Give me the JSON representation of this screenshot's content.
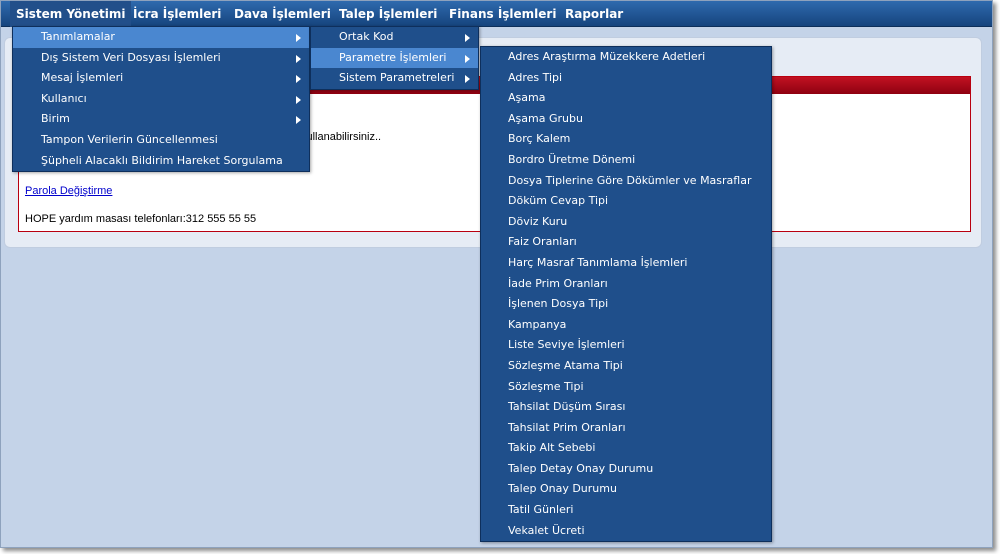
{
  "menubar": {
    "items": [
      {
        "label": "Sistem Yönetimi"
      },
      {
        "label": "İcra İşlemleri"
      },
      {
        "label": "Dava İşlemleri"
      },
      {
        "label": "Talep İşlemleri"
      },
      {
        "label": "Finans İşlemleri"
      },
      {
        "label": "Raporlar"
      }
    ]
  },
  "content": {
    "info_text": "kullanabilirsiniz..",
    "password_link": "Parola Değiştirme",
    "help_text": "HOPE yardım masası telefonları:312 555 55 55"
  },
  "menu1": {
    "items": [
      {
        "label": "Tanımlamalar"
      },
      {
        "label": "Dış Sistem Veri Dosyası İşlemleri"
      },
      {
        "label": "Mesaj İşlemleri"
      },
      {
        "label": "Kullanıcı"
      },
      {
        "label": "Birim"
      },
      {
        "label": "Tampon Verilerin Güncellenmesi"
      },
      {
        "label": "Şüpheli Alacaklı Bildirim Hareket Sorgulama"
      }
    ]
  },
  "menu2": {
    "items": [
      {
        "label": "Ortak Kod"
      },
      {
        "label": "Parametre İşlemleri"
      },
      {
        "label": "Sistem Parametreleri"
      }
    ]
  },
  "menu3": {
    "items": [
      {
        "label": "Adres Araştırma Müzekkere Adetleri"
      },
      {
        "label": "Adres Tipi"
      },
      {
        "label": "Aşama"
      },
      {
        "label": "Aşama Grubu"
      },
      {
        "label": "Borç Kalem"
      },
      {
        "label": "Bordro Üretme Dönemi"
      },
      {
        "label": "Dosya Tiplerine Göre Dökümler ve Masraflar"
      },
      {
        "label": "Döküm Cevap Tipi"
      },
      {
        "label": "Döviz Kuru"
      },
      {
        "label": "Faiz Oranları"
      },
      {
        "label": "Harç Masraf Tanımlama İşlemleri"
      },
      {
        "label": "İade Prim Oranları"
      },
      {
        "label": "İşlenen Dosya Tipi"
      },
      {
        "label": "Kampanya"
      },
      {
        "label": "Liste Seviye İşlemleri"
      },
      {
        "label": "Sözleşme Atama Tipi"
      },
      {
        "label": "Sözleşme Tipi"
      },
      {
        "label": "Tahsilat Düşüm Sırası"
      },
      {
        "label": "Tahsilat Prim Oranları"
      },
      {
        "label": "Takip Alt Sebebi"
      },
      {
        "label": "Talep Detay Onay Durumu"
      },
      {
        "label": "Talep Onay Durumu"
      },
      {
        "label": "Tatil Günleri"
      },
      {
        "label": "Vekalet Ücreti"
      }
    ]
  }
}
